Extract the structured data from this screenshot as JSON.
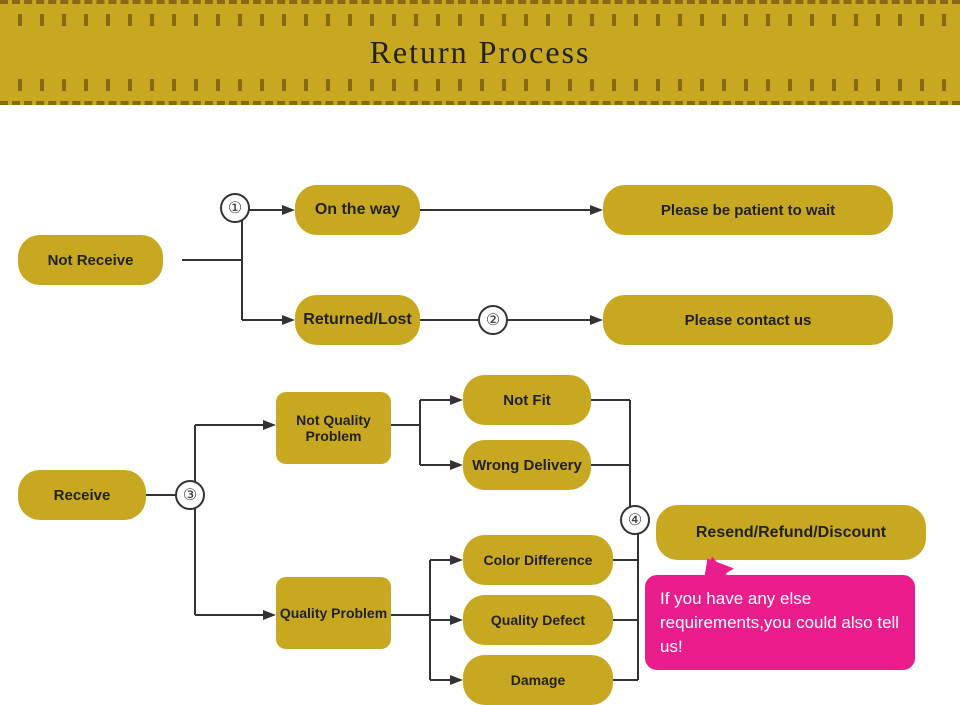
{
  "header": {
    "title": "Return Process",
    "stripe_color": "#c8a820",
    "dash_color": "#8b6914"
  },
  "boxes": {
    "not_receive": {
      "label": "Not Receive"
    },
    "on_the_way": {
      "label": "On the way"
    },
    "returned_lost": {
      "label": "Returned/Lost"
    },
    "please_patient": {
      "label": "Please be patient to wait"
    },
    "please_contact": {
      "label": "Please contact us"
    },
    "receive": {
      "label": "Receive"
    },
    "not_quality_problem": {
      "label": "Not Quality Problem"
    },
    "quality_problem": {
      "label": "Quality Problem"
    },
    "not_fit": {
      "label": "Not Fit"
    },
    "wrong_delivery": {
      "label": "Wrong Delivery"
    },
    "color_difference": {
      "label": "Color Difference"
    },
    "quality_defect": {
      "label": "Quality Defect"
    },
    "damage": {
      "label": "Damage"
    },
    "resend_refund": {
      "label": "Resend/Refund/Discount"
    }
  },
  "circles": {
    "c1": "①",
    "c2": "②",
    "c3": "③",
    "c4": "④"
  },
  "speech": {
    "text": "If you have any else requirements,you could also tell us!"
  }
}
